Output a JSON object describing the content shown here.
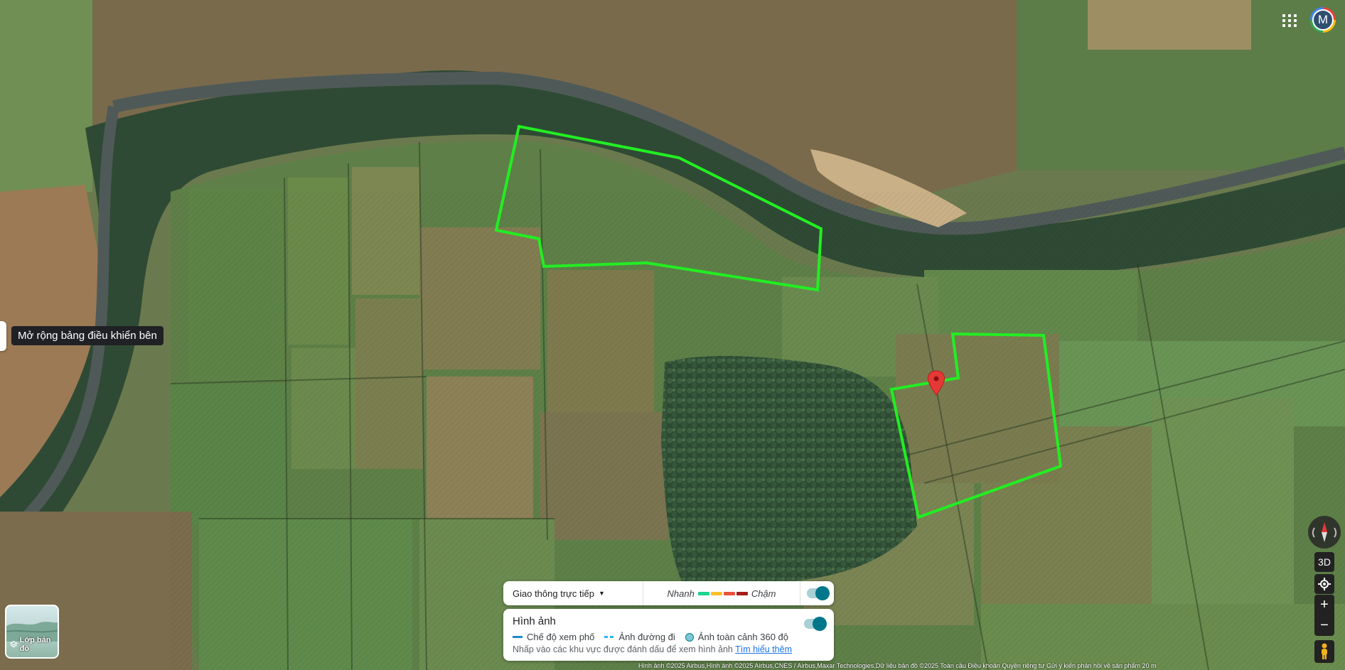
{
  "expand_panel": {
    "tooltip": "Mở rộng bảng điều khiển bên"
  },
  "account": {
    "initial": "M"
  },
  "controls": {
    "tilt_3d": "3D",
    "zoom_in": "+",
    "zoom_out": "−"
  },
  "layers": {
    "label": "Lớp bản đồ"
  },
  "traffic": {
    "title": "Giao thông trực tiếp",
    "fast": "Nhanh",
    "slow": "Chậm",
    "colors": [
      "#1ed291",
      "#f9c12b",
      "#e8523e",
      "#a51c1c"
    ]
  },
  "imagery": {
    "title": "Hình ảnh",
    "legend": [
      "Chế độ xem phố",
      "Ảnh đường đi",
      "Ảnh toàn cảnh 360 độ"
    ],
    "note": "Nhấp vào các khu vực được đánh dấu để xem hình ảnh",
    "learn_more": "Tìm hiểu thêm"
  },
  "attribution": "Hình ảnh ©2025 Airbus,Hình ảnh ©2025 Airbus,CNES / Airbus,Maxar Technologies,Dữ liệu bản đồ ©2025    Toàn cầu    Điều khoản    Quyền riêng tư    Gửi ý kiến phản hồi về sản phẩm    20 m",
  "colors": {
    "parcel_outline": "#22ee22",
    "pin": "#e53935"
  }
}
